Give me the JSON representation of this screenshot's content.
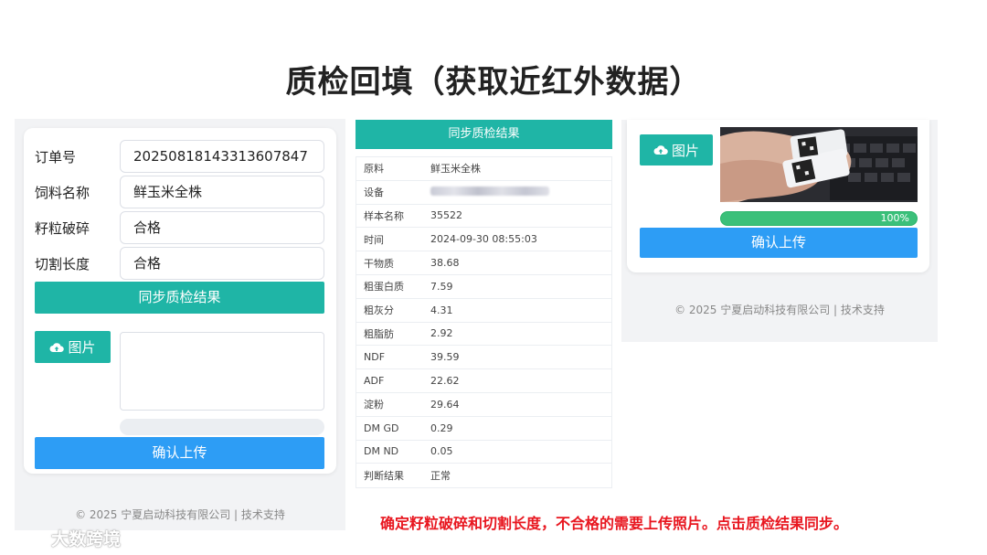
{
  "title": "质检回填（获取近红外数据）",
  "form": {
    "order_label": "订单号",
    "order_value": "20250818143313607847",
    "feed_label": "饲料名称",
    "feed_value": "鲜玉米全株",
    "grain_label": "籽粒破碎",
    "grain_value": "合格",
    "cut_label": "切割长度",
    "cut_value": "合格",
    "sync_button": "同步质检结果",
    "image_button": "图片",
    "upload_progress": 0,
    "confirm_button": "确认上传",
    "footer": "© 2025 宁夏启动科技有限公司 | 技术支持"
  },
  "result": {
    "header": "同步质检结果",
    "rows": [
      {
        "key": "原料",
        "value": "鲜玉米全株"
      },
      {
        "key": "设备",
        "value": ""
      },
      {
        "key": "样本名称",
        "value": "35522"
      },
      {
        "key": "时间",
        "value": "2024-09-30 08:55:03"
      },
      {
        "key": "干物质",
        "value": "38.68"
      },
      {
        "key": "粗蛋白质",
        "value": "7.59"
      },
      {
        "key": "粗灰分",
        "value": "4.31"
      },
      {
        "key": "粗脂肪",
        "value": "2.92"
      },
      {
        "key": "NDF",
        "value": "39.59"
      },
      {
        "key": "ADF",
        "value": "22.62"
      },
      {
        "key": "淀粉",
        "value": "29.64"
      },
      {
        "key": "DM GD",
        "value": "0.29"
      },
      {
        "key": "DM ND",
        "value": "0.05"
      },
      {
        "key": "判断结果",
        "value": "正常"
      }
    ]
  },
  "upload": {
    "image_button": "图片",
    "progress_text": "100%",
    "progress": 1.0,
    "confirm_button": "确认上传",
    "footer": "© 2025 宁夏启动科技有限公司 | 技术支持"
  },
  "note": "确定籽粒破碎和切割长度，不合格的需要上传照片。点击质检结果同步。",
  "watermark": "大数跨境",
  "colors": {
    "teal": "#1fb5a6",
    "blue": "#2d9df5",
    "green": "#3bc07a",
    "note_red": "#e8161f"
  }
}
